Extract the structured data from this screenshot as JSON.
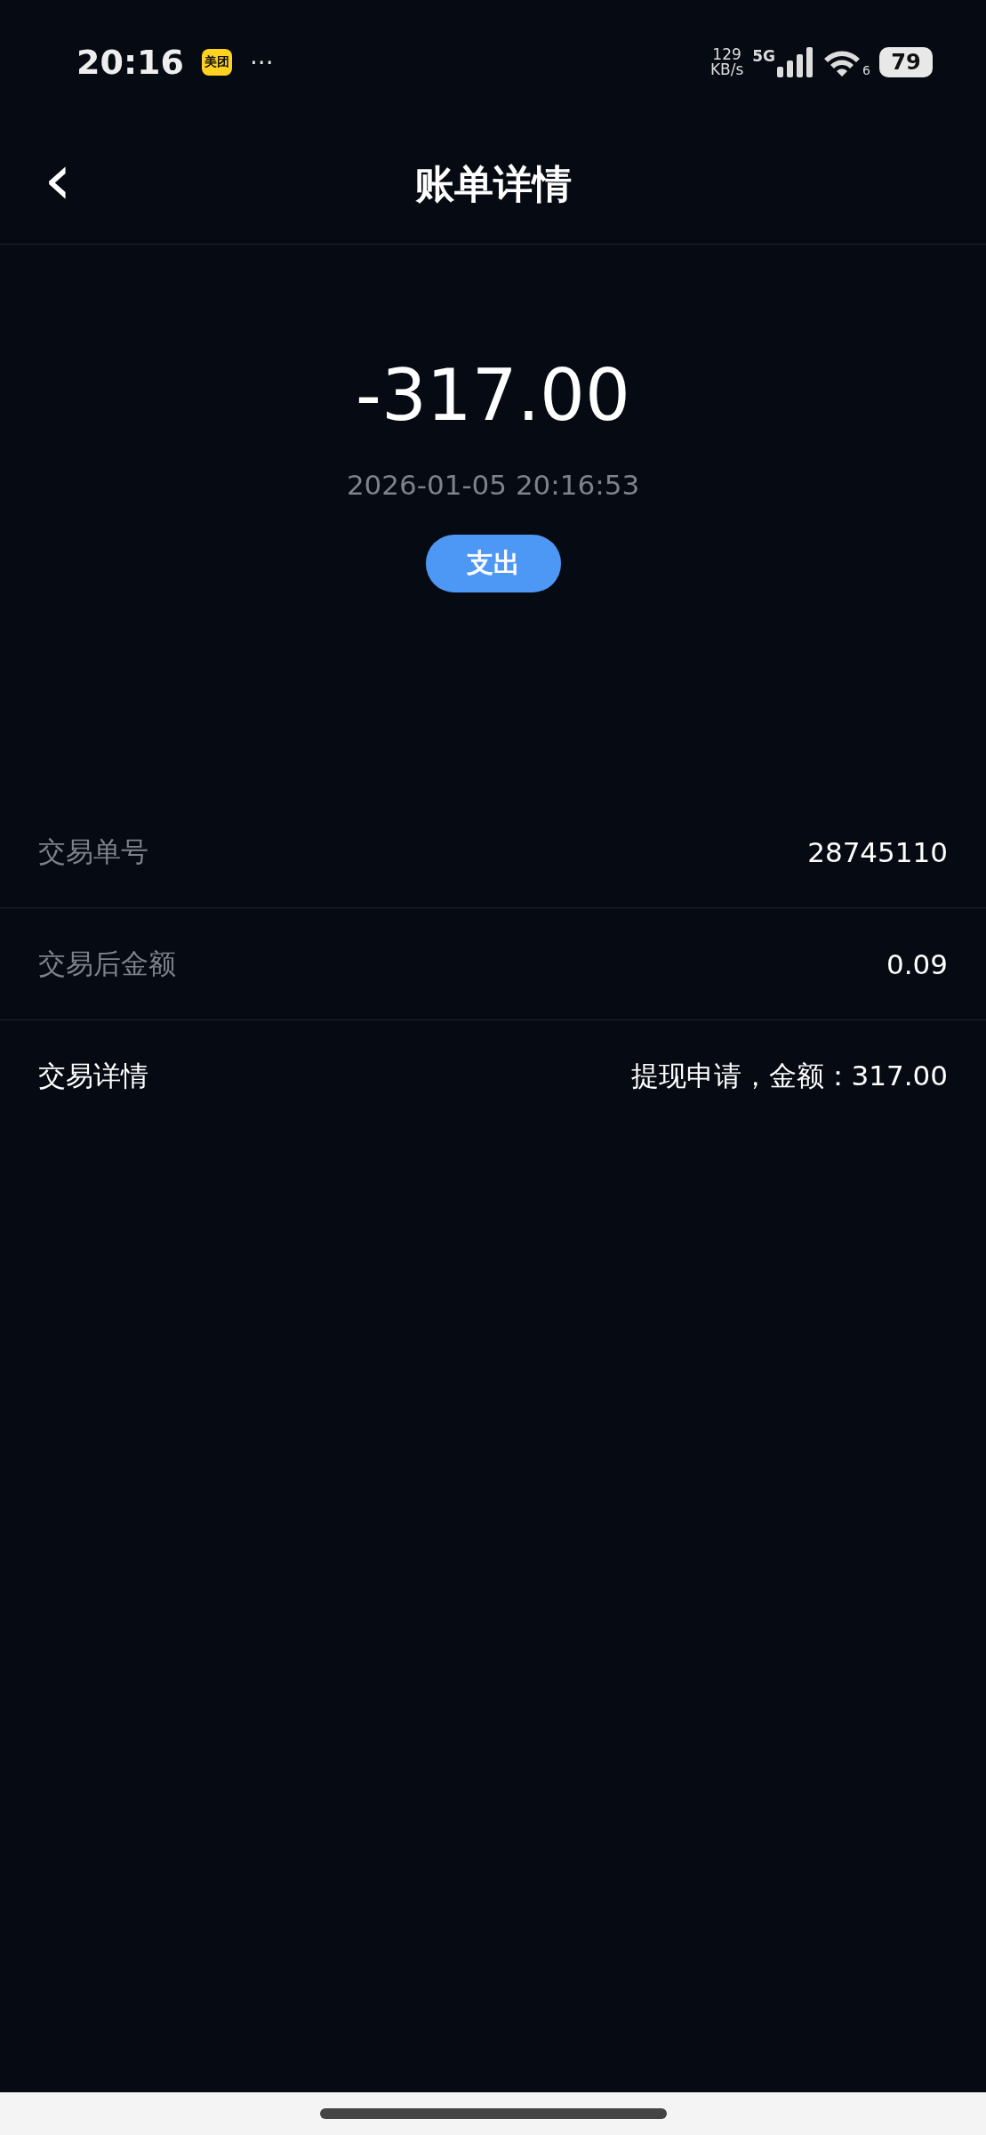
{
  "status_bar": {
    "time": "20:16",
    "app_badge": "美团",
    "more": "···",
    "speed": "129",
    "speed_unit": "KB/s",
    "network": "5G",
    "wifi_label": "6",
    "battery": "79"
  },
  "header": {
    "back": "‹",
    "title": "账单详情"
  },
  "summary": {
    "amount": "-317.00",
    "datetime": "2026-01-05 20:16:53",
    "type_tag": "支出"
  },
  "rows": [
    {
      "label": "交易单号",
      "value": "28745110",
      "emphasis": false
    },
    {
      "label": "交易后金额",
      "value": "0.09",
      "emphasis": false
    },
    {
      "label": "交易详情",
      "value": "提现申请，金额：317.00",
      "emphasis": true
    }
  ]
}
